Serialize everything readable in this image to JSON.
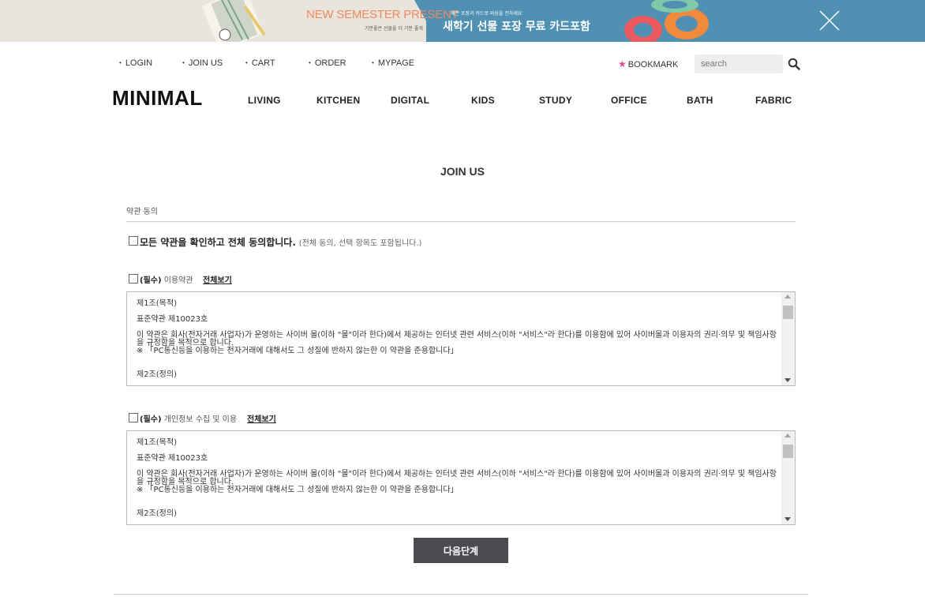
{
  "banner": {
    "headline": "NEW SEMESTER PRESENT",
    "headline_sub": "기분좋은 선물을 더 기분 좋게",
    "small_text": "예쁜 포장과 카드로 마음을 전하세요",
    "promo": "새학기 선물 포장 무료 카드포함",
    "close_icon": "close-icon",
    "colors": {
      "left_bg": "#e9e4dc",
      "right_bg": "#4f90b3",
      "headline": "#ef8a61"
    }
  },
  "util_links": [
    "LOGIN",
    "JOIN US",
    "CART",
    "ORDER",
    "MYPAGE"
  ],
  "bookmark": {
    "label": "BOOKMARK",
    "icon": "star-icon",
    "color": "#e64b8a"
  },
  "search": {
    "placeholder": "search",
    "icon": "search-icon"
  },
  "logo": "MINIMAL",
  "nav": [
    "LIVING",
    "KITCHEN",
    "DIGITAL",
    "KIDS",
    "STUDY",
    "OFFICE",
    "BATH",
    "FABRIC"
  ],
  "page_title": "JOIN US",
  "section_label": "약관 동의",
  "agree_all": {
    "label": "모든 약관을 확인하고 전체 동의합니다.",
    "note": "(전체 동의, 선택 항목도 포함됩니다.)"
  },
  "terms": [
    {
      "required": "(필수)",
      "title": "이용약관",
      "view_all": "전체보기",
      "lines": [
        "제1조(목적)",
        "표준약관 제10023호",
        "이 약관은 회사(전자거래 사업자)가 운영하는 사이버 몰(이하 \"몰\"이라 한다)에서 제공하는 인터넷 관련 서비스(이하 \"서비스\"라 한다)를 이용함에 있어 사이버몰과 이용자의 권리·의무 및 책임사항을 규정함을 목적으로 합니다.",
        "※ 「PC통신등을 이용하는 전자거래에 대해서도 그 성질에 반하지 않는한 이 약관을 준용합니다」",
        "제2조(정의)"
      ]
    },
    {
      "required": "(필수)",
      "title": "개인정보 수집 및 이용",
      "view_all": "전체보기",
      "lines": [
        "제1조(목적)",
        "표준약관 제10023호",
        "이 약관은 회사(전자거래 사업자)가 운영하는 사이버 몰(이하 \"몰\"이라 한다)에서 제공하는 인터넷 관련 서비스(이하 \"서비스\"라 한다)를 이용함에 있어 사이버몰과 이용자의 권리·의무 및 책임사항을 규정함을 목적으로 합니다.",
        "※ 「PC통신등을 이용하는 전자거래에 대해서도 그 성질에 반하지 않는한 이 약관을 준용합니다」",
        "제2조(정의)"
      ]
    }
  ],
  "next_button": "다음단계",
  "accent": {
    "button_bg": "#4a4c52"
  }
}
